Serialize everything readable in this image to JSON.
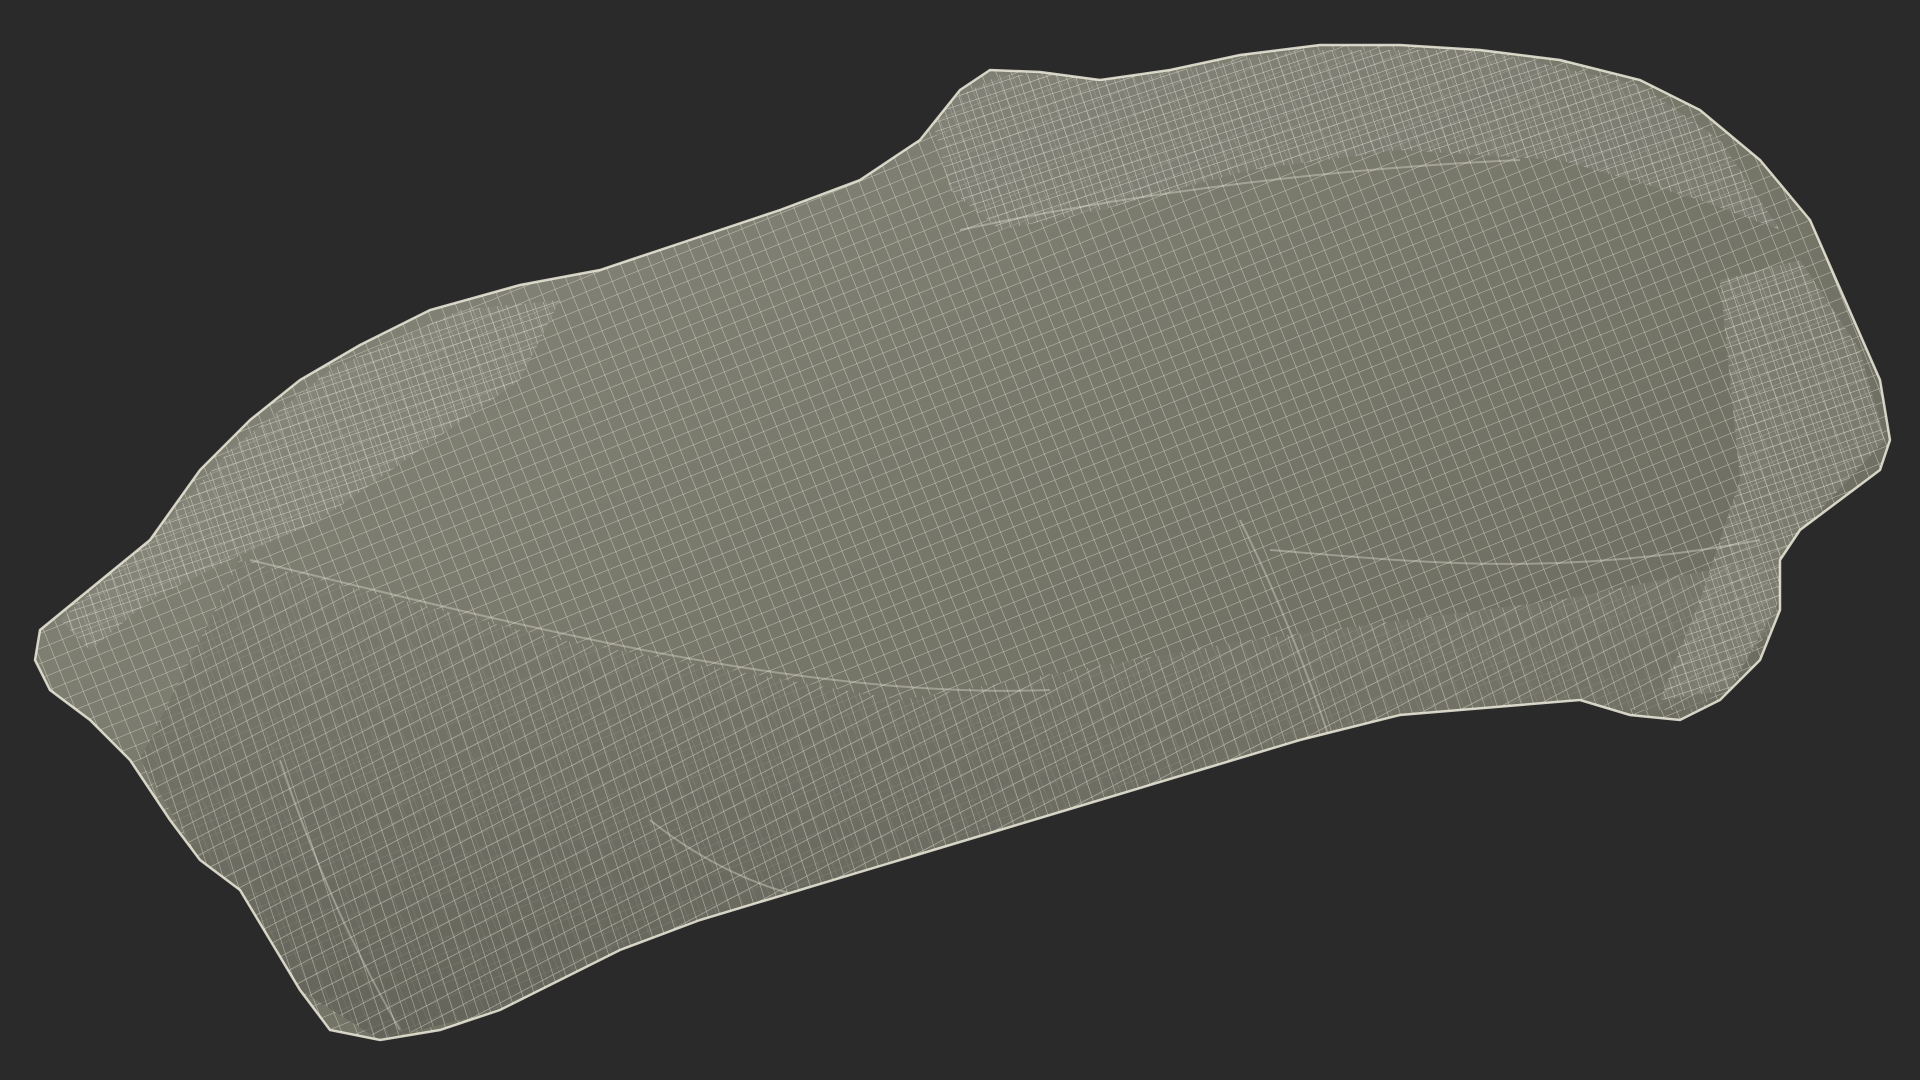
{
  "scene": {
    "subject": "car-cover-wireframe",
    "render_mode": "wireframe",
    "background_color": "#2a2a2a",
    "surface_color": "#7d7d72",
    "surface_shadow_color": "#5e5e56",
    "wire_color": "#e9e6d6",
    "wire_opacity": 0.62
  }
}
